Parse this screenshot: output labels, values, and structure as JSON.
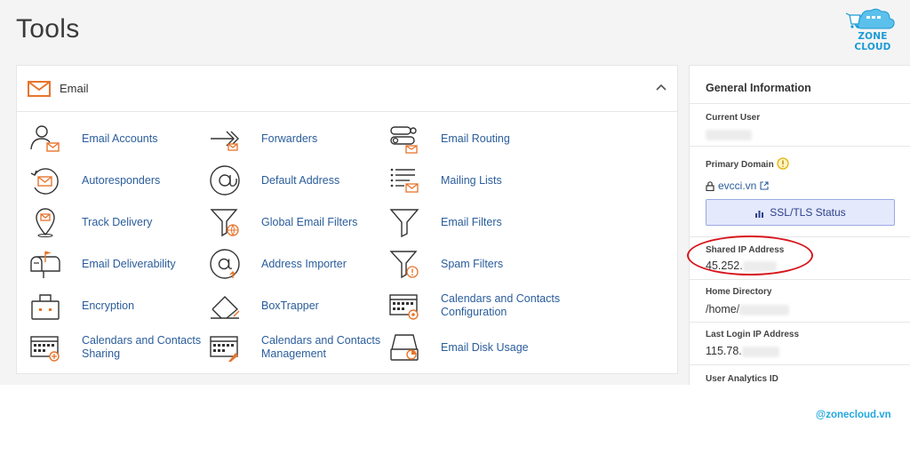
{
  "page": {
    "title": "Tools"
  },
  "logo": {
    "text": "ZONE CLOUD",
    "color": "#1b9ad6"
  },
  "email_panel": {
    "label": "Email",
    "tools": [
      {
        "label": "Email Accounts",
        "icon": "user-mail-icon"
      },
      {
        "label": "Forwarders",
        "icon": "forward-arrow-icon"
      },
      {
        "label": "Email Routing",
        "icon": "routing-icon"
      },
      {
        "label": "Autoresponders",
        "icon": "autoresponder-icon"
      },
      {
        "label": "Default Address",
        "icon": "at-sign-icon"
      },
      {
        "label": "Mailing Lists",
        "icon": "list-mail-icon"
      },
      {
        "label": "Track Delivery",
        "icon": "map-pin-icon"
      },
      {
        "label": "Global Email Filters",
        "icon": "global-filter-icon"
      },
      {
        "label": "Email Filters",
        "icon": "filter-icon"
      },
      {
        "label": "Email Deliverability",
        "icon": "mailbox-icon"
      },
      {
        "label": "Address Importer",
        "icon": "at-import-icon"
      },
      {
        "label": "Spam Filters",
        "icon": "spam-filter-icon"
      },
      {
        "label": "Encryption",
        "icon": "lock-box-icon"
      },
      {
        "label": "BoxTrapper",
        "icon": "boxtrapper-icon"
      },
      {
        "label": "Calendars and Contacts\nConfiguration",
        "icon": "calendar-config-icon"
      },
      {
        "label": "Calendars and Contacts\nSharing",
        "icon": "calendar-share-icon"
      },
      {
        "label": "Calendars and Contacts\nManagement",
        "icon": "calendar-manage-icon"
      },
      {
        "label": "Email Disk Usage",
        "icon": "disk-usage-icon"
      }
    ]
  },
  "general_info": {
    "title": "General Information",
    "current_user_label": "Current User",
    "primary_domain_label": "Primary Domain",
    "primary_domain": "evcci.vn",
    "ssl_button": "SSL/TLS Status",
    "shared_ip_label": "Shared IP Address",
    "shared_ip": "45.252.",
    "home_dir_label": "Home Directory",
    "home_dir": "/home/",
    "last_login_label": "Last Login IP Address",
    "last_login_ip": "115.78.",
    "analytics_label": "User Analytics ID"
  },
  "watermark": "@zonecloud.vn",
  "colors": {
    "accent_orange": "#e8742c",
    "link_blue": "#2a5d9b",
    "highlight_red": "#d7171e"
  }
}
